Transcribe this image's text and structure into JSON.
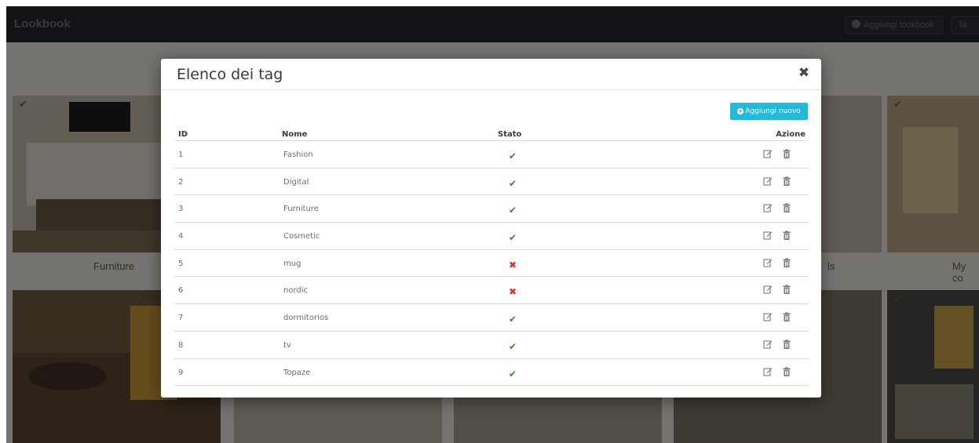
{
  "topbar": {
    "brand": "Lookbook",
    "add_label": "Aggiungi lookbook",
    "tag_label": "Ta"
  },
  "gallery": {
    "captions": [
      "Furniture",
      "ls",
      "My co"
    ]
  },
  "modal": {
    "title": "Elenco dei tag",
    "close_symbol": "✖",
    "add_button_label": "Aggiungi nuovo",
    "columns": {
      "id": "ID",
      "name": "Nome",
      "status": "Stato",
      "action": "Azione"
    },
    "rows": [
      {
        "id": "1",
        "name": "Fashion",
        "active": true
      },
      {
        "id": "2",
        "name": "Digital",
        "active": true
      },
      {
        "id": "3",
        "name": "Furniture",
        "active": true
      },
      {
        "id": "4",
        "name": "Cosmetic",
        "active": true
      },
      {
        "id": "5",
        "name": "mug",
        "active": false
      },
      {
        "id": "6",
        "name": "nordic",
        "active": false
      },
      {
        "id": "7",
        "name": "dormitorios",
        "active": true
      },
      {
        "id": "8",
        "name": "tv",
        "active": true
      },
      {
        "id": "9",
        "name": "Topaze",
        "active": true
      }
    ],
    "status_icons": {
      "active": "✔",
      "inactive": "✖"
    }
  },
  "colors": {
    "accent": "#25b9d7",
    "ok": "#3b8a3b",
    "error": "#d33a2c",
    "topbar": "#23272d"
  },
  "icons": {
    "edit": "edit-icon",
    "delete": "trash-icon",
    "close": "close-icon",
    "add": "plus-circle-icon",
    "status_ok": "check-icon",
    "status_no": "cross-icon"
  }
}
